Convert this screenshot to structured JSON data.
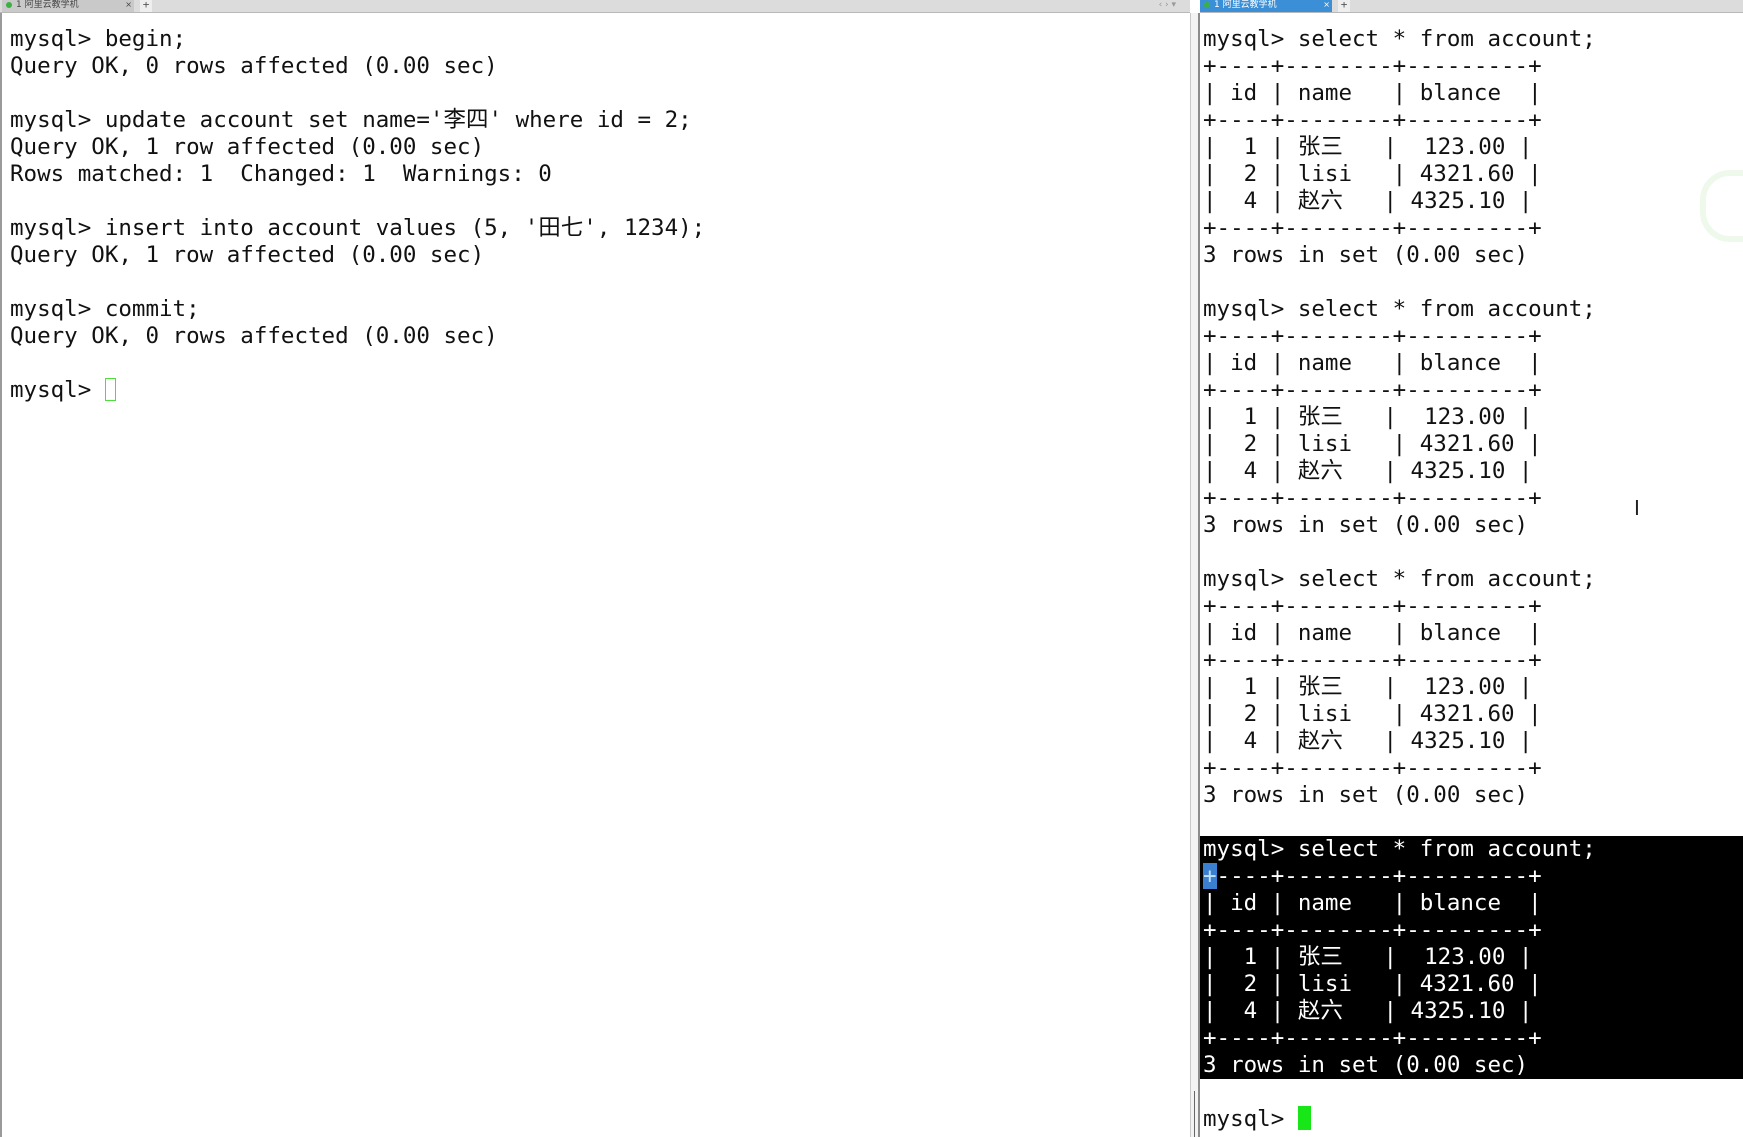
{
  "tabs": {
    "left": {
      "label": "1 阿里云教学机",
      "close": "×",
      "new": "+"
    },
    "right": {
      "label": "1 阿里云教学机",
      "close": "×",
      "new": "+"
    },
    "nav": "‹ ›  ▾"
  },
  "left_terminal": {
    "lines": [
      "mysql> begin;",
      "Query OK, 0 rows affected (0.00 sec)",
      "",
      "mysql> update account set name='李四' where id = 2;",
      "Query OK, 1 row affected (0.00 sec)",
      "Rows matched: 1  Changed: 1  Warnings: 0",
      "",
      "mysql> insert into account values (5, '田七', 1234);",
      "Query OK, 1 row affected (0.00 sec)",
      "",
      "mysql> commit;",
      "Query OK, 0 rows affected (0.00 sec)",
      ""
    ],
    "prompt": "mysql> "
  },
  "right_terminal": {
    "query": "mysql> select * from account;",
    "border": "+----+--------+---------+",
    "border_sel_rest": "----+--------+---------+",
    "border_sel_char": "+",
    "header": "| id | name   | blance  |",
    "rows": [
      "|  1 | 张三   |  123.00 |",
      "|  2 | lisi   | 4321.60 |",
      "|  4 | 赵六   | 4325.10 |"
    ],
    "footer": "3 rows in set (0.00 sec)",
    "prompt": "mysql> "
  }
}
